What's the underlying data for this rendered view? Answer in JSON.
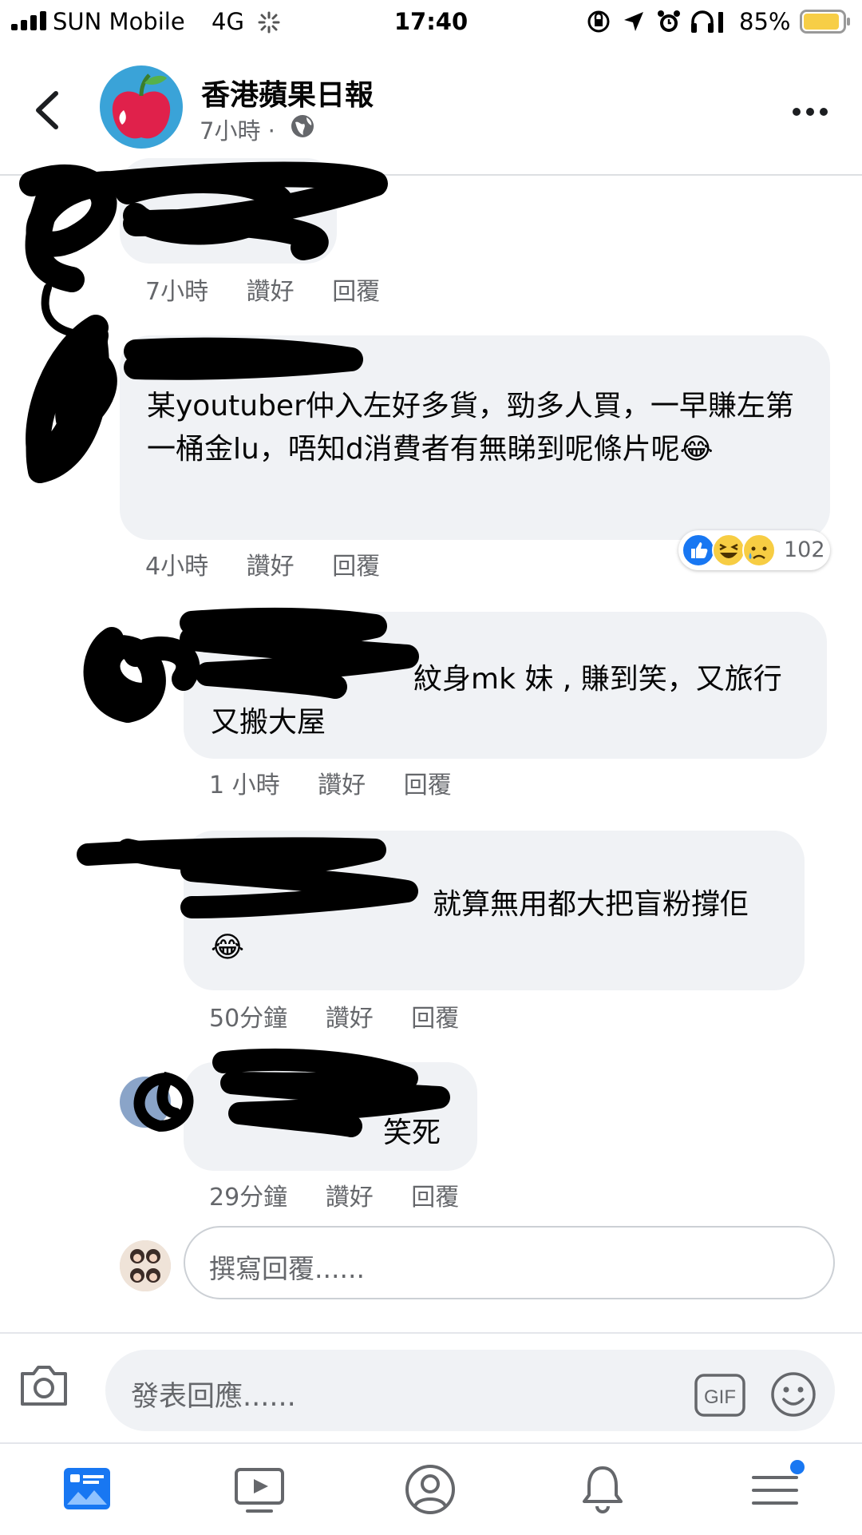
{
  "status_bar": {
    "carrier": "SUN Mobile",
    "network": "4G",
    "time": "17:40",
    "battery": "85%"
  },
  "header": {
    "page_name": "香港蘋果日報",
    "post_time": "7小時 ·",
    "icons": [
      "back-icon",
      "globe-icon",
      "more-icon"
    ]
  },
  "comments": [
    {
      "text": "",
      "time": "7小時",
      "like": "讚好",
      "reply": "回覆"
    },
    {
      "text": "某youtuber仲入左好多貨，勁多人買，一早賺左第一桶金lu，唔知d消費者有無睇到呢條片呢",
      "emoji": "😂",
      "time": "4小時",
      "like": "讚好",
      "reply": "回覆",
      "reaction_count": "102"
    },
    {
      "text": "紋身mk 妹 , 賺到笑，又旅行又搬大屋",
      "time": "1 小時",
      "like": "讚好",
      "reply": "回覆"
    },
    {
      "text": "就算無用都大把盲粉撐佢",
      "emoji": "😂",
      "time": "50分鐘",
      "like": "讚好",
      "reply": "回覆"
    },
    {
      "text": "笑死",
      "time": "29分鐘",
      "like": "讚好",
      "reply": "回覆"
    }
  ],
  "reply_box": {
    "placeholder": "撰寫回覆......"
  },
  "composer": {
    "placeholder": "發表回應......",
    "gif_label": "GIF"
  },
  "tab_bar": {
    "items": [
      "news-feed-icon",
      "watch-icon",
      "profile-icon",
      "notifications-icon",
      "menu-icon"
    ]
  },
  "colors": {
    "accent": "#1877f2",
    "bubble": "#f0f2f5",
    "secondary_text": "#65676b",
    "battery_fill": "#f7ce46"
  }
}
